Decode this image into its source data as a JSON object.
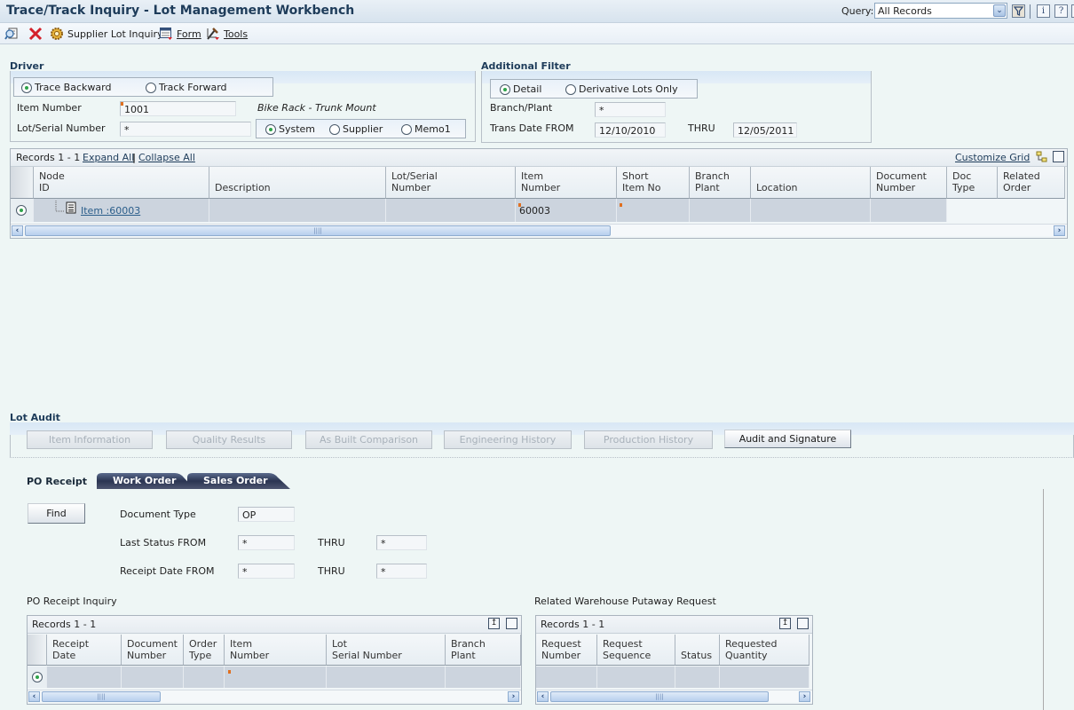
{
  "window": {
    "title": "Trace/Track Inquiry - Lot Management Workbench",
    "query_label": "Query:",
    "query_value": "All Records",
    "icons": [
      "filter-icon",
      "info-icon",
      "help-icon"
    ]
  },
  "toolbar": {
    "items": [
      {
        "icon": "select-icon",
        "label": ""
      },
      {
        "icon": "close-icon",
        "label": ""
      },
      {
        "icon": "gear-icon",
        "label": "Supplier Lot Inquiry"
      },
      {
        "icon": "form-icon",
        "label": "Form"
      },
      {
        "icon": "tools-icon",
        "label": "Tools"
      }
    ]
  },
  "driver": {
    "title": "Driver",
    "direction": [
      {
        "label": "Trace Backward",
        "selected": true
      },
      {
        "label": "Track Forward",
        "selected": false
      }
    ],
    "item_number_label": "Item Number",
    "item_number_value": "1001",
    "item_description": "Bike Rack - Trunk Mount",
    "lot_label": "Lot/Serial Number",
    "lot_value": "*",
    "lot_type": [
      {
        "label": "System",
        "selected": true
      },
      {
        "label": "Supplier",
        "selected": false
      },
      {
        "label": "Memo1",
        "selected": false
      }
    ]
  },
  "filter": {
    "title": "Additional Filter",
    "mode": [
      {
        "label": "Detail",
        "selected": true
      },
      {
        "label": "Derivative Lots Only",
        "selected": false
      }
    ],
    "branch_label": "Branch/Plant",
    "branch_value": "*",
    "trans_from_label": "Trans Date FROM",
    "trans_from_value": "12/10/2010",
    "thru_label": "THRU",
    "trans_thru_value": "12/05/2011"
  },
  "main_grid": {
    "records": "Records 1 - 1",
    "expand_all": "Expand All",
    "separator": "|",
    "collapse_all": "Collapse All",
    "customize": "Customize Grid",
    "columns": [
      [
        "Node",
        "ID"
      ],
      [
        "",
        "Description"
      ],
      [
        "Lot/Serial",
        "Number"
      ],
      [
        "Item",
        "Number"
      ],
      [
        "Short",
        "Item No"
      ],
      [
        "Branch",
        "Plant"
      ],
      [
        "",
        "Location"
      ],
      [
        "Document",
        "Number"
      ],
      [
        "Doc",
        "Type"
      ],
      [
        "Related",
        "Order"
      ]
    ],
    "rows": [
      {
        "node": "Item :60003",
        "description": "",
        "lot": "",
        "item": "60003",
        "short_item": "",
        "branch": "",
        "location": "",
        "document": "",
        "doc_type": "",
        "related": ""
      }
    ]
  },
  "lot_audit": {
    "title": "Lot Audit",
    "buttons": [
      {
        "label": "Item Information",
        "enabled": false
      },
      {
        "label": "Quality Results",
        "enabled": false
      },
      {
        "label": "As Built Comparison",
        "enabled": false
      },
      {
        "label": "Engineering History",
        "enabled": false
      },
      {
        "label": "Production History",
        "enabled": false
      },
      {
        "label": "Audit and Signature",
        "enabled": true
      }
    ]
  },
  "tabs": [
    {
      "label": "PO Receipt",
      "active": true
    },
    {
      "label": "Work Order",
      "active": false
    },
    {
      "label": "Sales Order",
      "active": false
    }
  ],
  "po_receipt": {
    "find_label": "Find",
    "doc_type_label": "Document Type",
    "doc_type_value": "OP",
    "last_status_label": "Last Status FROM",
    "last_status_from": "*",
    "thru_label": "THRU",
    "last_status_thru": "*",
    "receipt_date_label": "Receipt Date FROM",
    "receipt_date_from": "*",
    "receipt_date_thru": "*"
  },
  "po_grid": {
    "title": "PO Receipt Inquiry",
    "records": "Records 1 - 1",
    "columns": [
      [
        "Receipt",
        "Date"
      ],
      [
        "Document",
        "Number"
      ],
      [
        "Order",
        "Type"
      ],
      [
        "Item",
        "Number"
      ],
      [
        "Lot",
        "Serial Number"
      ],
      [
        "Branch",
        "Plant"
      ]
    ]
  },
  "wh_grid": {
    "title": "Related Warehouse Putaway Request",
    "records": "Records 1 - 1",
    "columns": [
      [
        "Request",
        "Number"
      ],
      [
        "Request",
        "Sequence"
      ],
      [
        "",
        "Status"
      ],
      [
        "Requested",
        "Quantity"
      ]
    ]
  }
}
